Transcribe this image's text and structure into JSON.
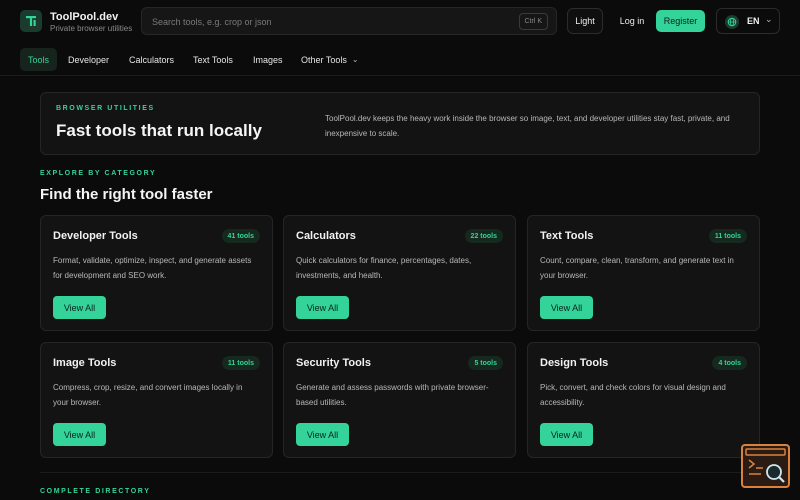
{
  "brand": {
    "name": "ToolPool.dev",
    "tagline": "Private browser utilities",
    "logo_letter": "T"
  },
  "search": {
    "placeholder": "Search tools, e.g. crop or json",
    "shortcut": "Ctrl K"
  },
  "header": {
    "theme_label": "Light",
    "login_label": "Log in",
    "register_label": "Register",
    "language": "EN"
  },
  "nav": {
    "items": [
      {
        "label": "Tools",
        "active": true
      },
      {
        "label": "Developer"
      },
      {
        "label": "Calculators"
      },
      {
        "label": "Text Tools"
      },
      {
        "label": "Images"
      },
      {
        "label": "Other Tools"
      }
    ]
  },
  "hero": {
    "eyebrow": "BROWSER UTILITIES",
    "title": "Fast tools that run locally",
    "description": "ToolPool.dev keeps the heavy work inside the browser so image, text, and developer utilities stay fast, private, and inexpensive to scale."
  },
  "explore": {
    "eyebrow": "EXPLORE BY CATEGORY",
    "title": "Find the right tool faster"
  },
  "categories": [
    {
      "title": "Developer Tools",
      "count": "41 tools",
      "description": "Format, validate, optimize, inspect, and generate assets for development and SEO work.",
      "button": "View All"
    },
    {
      "title": "Calculators",
      "count": "22 tools",
      "description": "Quick calculators for finance, percentages, dates, investments, and health.",
      "button": "View All"
    },
    {
      "title": "Text Tools",
      "count": "11 tools",
      "description": "Count, compare, clean, transform, and generate text in your browser.",
      "button": "View All"
    },
    {
      "title": "Image Tools",
      "count": "11 tools",
      "description": "Compress, crop, resize, and convert images locally in your browser.",
      "button": "View All"
    },
    {
      "title": "Security Tools",
      "count": "5 tools",
      "description": "Generate and assess passwords with private browser-based utilities.",
      "button": "View All"
    },
    {
      "title": "Design Tools",
      "count": "4 tools",
      "description": "Pick, convert, and check colors for visual design and accessibility.",
      "button": "View All"
    }
  ],
  "directory": {
    "eyebrow": "COMPLETE DIRECTORY"
  },
  "colors": {
    "accent": "#34d399",
    "background": "#0b0b0b",
    "card": "#131313",
    "float_border": "#d9823f"
  },
  "icons": {
    "logo": "toolpool-logo-icon",
    "language": "globe-icon",
    "dropdown": "chevron-down-icon",
    "floating": "terminal-search-icon"
  }
}
